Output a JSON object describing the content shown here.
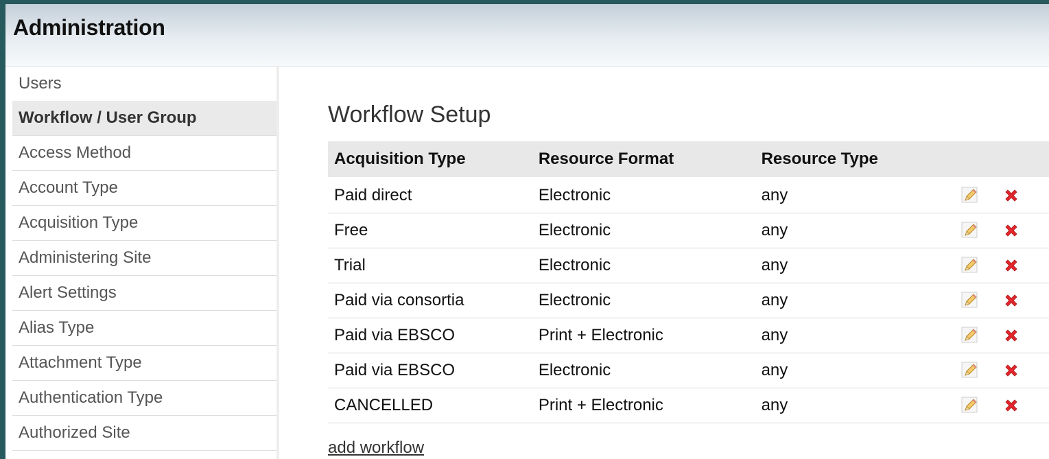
{
  "header": {
    "title": "Administration"
  },
  "sidebar": {
    "items": [
      {
        "label": "Users",
        "active": false
      },
      {
        "label": "Workflow / User Group",
        "active": true
      },
      {
        "label": "Access Method",
        "active": false
      },
      {
        "label": "Account Type",
        "active": false
      },
      {
        "label": "Acquisition Type",
        "active": false
      },
      {
        "label": "Administering Site",
        "active": false
      },
      {
        "label": "Alert Settings",
        "active": false
      },
      {
        "label": "Alias Type",
        "active": false
      },
      {
        "label": "Attachment Type",
        "active": false
      },
      {
        "label": "Authentication Type",
        "active": false
      },
      {
        "label": "Authorized Site",
        "active": false
      }
    ]
  },
  "main": {
    "title": "Workflow Setup",
    "columns": [
      "Acquisition Type",
      "Resource Format",
      "Resource Type"
    ],
    "rows": [
      {
        "acquisition_type": "Paid direct",
        "resource_format": "Electronic",
        "resource_type": "any"
      },
      {
        "acquisition_type": "Free",
        "resource_format": "Electronic",
        "resource_type": "any"
      },
      {
        "acquisition_type": "Trial",
        "resource_format": "Electronic",
        "resource_type": "any"
      },
      {
        "acquisition_type": "Paid via consortia",
        "resource_format": "Electronic",
        "resource_type": "any"
      },
      {
        "acquisition_type": "Paid via EBSCO",
        "resource_format": "Print + Electronic",
        "resource_type": "any"
      },
      {
        "acquisition_type": "Paid via EBSCO",
        "resource_format": "Electronic",
        "resource_type": "any"
      },
      {
        "acquisition_type": "CANCELLED",
        "resource_format": "Print + Electronic",
        "resource_type": "any"
      }
    ],
    "row_actions": [
      "pencil-edit-icon",
      "red-x-delete-icon"
    ],
    "add_link": "add workflow"
  },
  "colors": {
    "background": "#275a5c",
    "active_item": "#eaeaea",
    "delete": "#e3262b",
    "pencil": "#f0c050"
  }
}
